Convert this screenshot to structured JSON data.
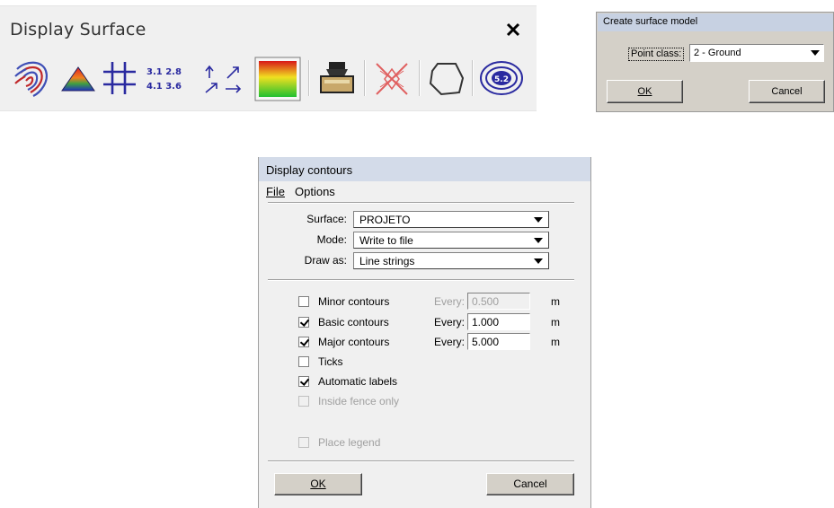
{
  "toolbar": {
    "title": "Display Surface",
    "close_glyph": "✕",
    "icons": [
      "contours-icon",
      "triangle-model-icon",
      "grid-icon",
      "elevation-labels-icon",
      "slope-arrows-icon",
      "color-gradient-icon",
      "inking-icon",
      "cross-x-icon",
      "boundary-shape-icon",
      "eye-view-icon"
    ],
    "elev_text": {
      "row1": "3.1 2.8",
      "row2": "4.1 3.6"
    },
    "eye_badge": "5.2",
    "colors": {
      "bg": "#f0f0f0",
      "contour_blue": "#3f4fb6",
      "contour_red": "#c0282a",
      "grid": "#2a2aa0"
    }
  },
  "create_surface_model": {
    "title": "Create surface model",
    "point_class_label": "Point class:",
    "point_class_value": "2 - Ground",
    "ok": "OK",
    "cancel": "Cancel"
  },
  "display_contours": {
    "title": "Display contours",
    "menu": {
      "file": "File",
      "options": "Options"
    },
    "surface_label": "Surface:",
    "surface_value": "PROJETO",
    "mode_label": "Mode:",
    "mode_value": "Write to file",
    "draw_as_label": "Draw as:",
    "draw_as_value": "Line strings",
    "options": [
      {
        "label": "Minor contours",
        "checked": false,
        "enabled": true,
        "every_label": "Every:",
        "every_value": "0.500",
        "every_enabled": false,
        "unit": "m"
      },
      {
        "label": "Basic contours",
        "checked": true,
        "enabled": true,
        "every_label": "Every:",
        "every_value": "1.000",
        "every_enabled": true,
        "unit": "m"
      },
      {
        "label": "Major contours",
        "checked": true,
        "enabled": true,
        "every_label": "Every:",
        "every_value": "5.000",
        "every_enabled": true,
        "unit": "m"
      },
      {
        "label": "Ticks",
        "checked": false,
        "enabled": true
      },
      {
        "label": "Automatic labels",
        "checked": true,
        "enabled": true
      },
      {
        "label": "Inside fence only",
        "checked": false,
        "enabled": false
      }
    ],
    "place_legend": {
      "label": "Place legend",
      "checked": false,
      "enabled": false
    },
    "ok": "OK",
    "cancel": "Cancel"
  }
}
